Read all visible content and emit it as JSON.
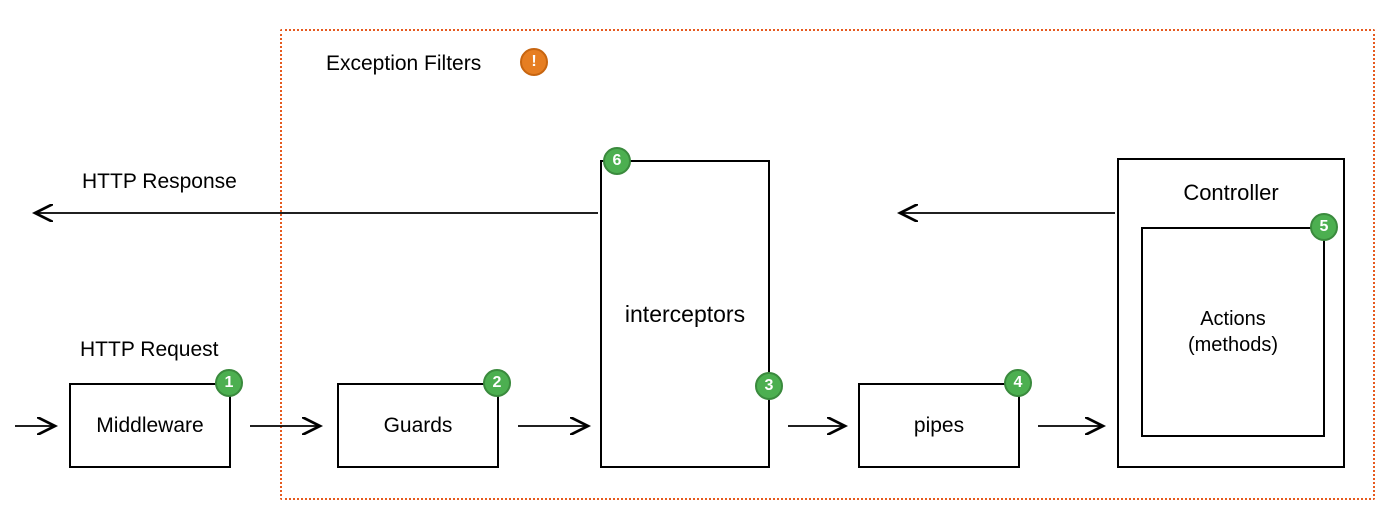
{
  "labels": {
    "exception_filters": "Exception Filters",
    "http_response": "HTTP Response",
    "http_request": "HTTP Request",
    "exclamation": "!"
  },
  "boxes": {
    "middleware": "Middleware",
    "guards": "Guards",
    "interceptors": "interceptors",
    "pipes": "pipes",
    "controller_title": "Controller",
    "controller_inner": "Actions\n(methods)"
  },
  "badges": {
    "b1": "1",
    "b2": "2",
    "b3": "3",
    "b4": "4",
    "b5": "5",
    "b6": "6"
  }
}
